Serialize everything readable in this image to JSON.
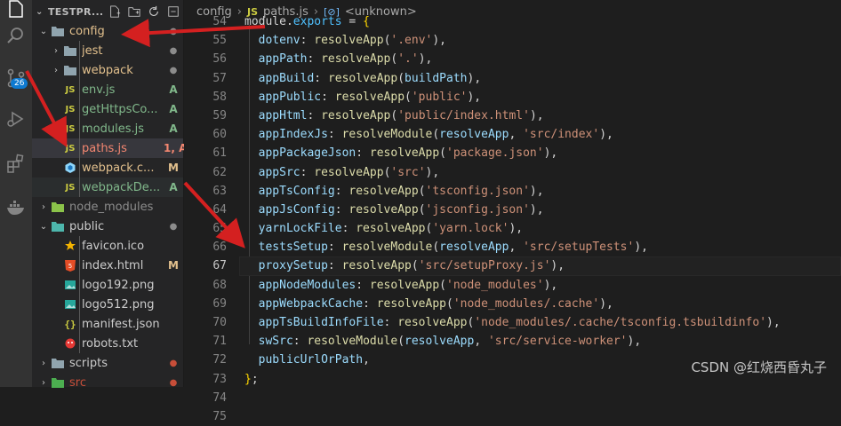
{
  "explorer": {
    "title": "TESTPR...",
    "actions": [
      "new-file-icon",
      "new-folder-icon",
      "refresh-icon",
      "collapse-all-icon"
    ]
  },
  "activity_bar": {
    "scm_badge": "26"
  },
  "tree": [
    {
      "label": "config",
      "type": "folder",
      "open": true,
      "indent": 0,
      "status": "dot",
      "statusColor": "#8c8c8c",
      "color": "#e2c08d"
    },
    {
      "label": "jest",
      "type": "folder",
      "open": false,
      "indent": 1,
      "status": "dot",
      "statusColor": "#8c8c8c",
      "color": "#e2c08d"
    },
    {
      "label": "webpack",
      "type": "folder",
      "open": false,
      "indent": 1,
      "status": "dot",
      "statusColor": "#8c8c8c",
      "color": "#e2c08d"
    },
    {
      "label": "env.js",
      "type": "js",
      "indent": 1,
      "status": "A",
      "statusColor": "#81b88b",
      "color": "#81b88b"
    },
    {
      "label": "getHttpsCo...",
      "type": "js",
      "indent": 1,
      "status": "A",
      "statusColor": "#81b88b",
      "color": "#81b88b"
    },
    {
      "label": "modules.js",
      "type": "js",
      "indent": 1,
      "status": "A",
      "statusColor": "#81b88b",
      "color": "#81b88b"
    },
    {
      "label": "paths.js",
      "type": "js",
      "indent": 1,
      "status": "1, A",
      "statusColor": "#f48771",
      "color": "#f48771",
      "selected": true
    },
    {
      "label": "webpack.c...",
      "type": "webpack",
      "indent": 1,
      "status": "M",
      "statusColor": "#e2c08d",
      "color": "#e2c08d"
    },
    {
      "label": "webpackDe...",
      "type": "js",
      "indent": 1,
      "status": "A",
      "statusColor": "#81b88b",
      "color": "#81b88b",
      "hover": true
    },
    {
      "label": "node_modules",
      "type": "nodefolder",
      "open": false,
      "indent": 0,
      "status": "",
      "statusColor": "#8c8c8c",
      "color": "#8c8c8c"
    },
    {
      "label": "public",
      "type": "publicfolder",
      "open": true,
      "indent": 0,
      "status": "dot",
      "statusColor": "#8c8c8c",
      "color": "#cccccc"
    },
    {
      "label": "favicon.ico",
      "type": "favicon",
      "indent": 1,
      "status": "",
      "statusColor": "#cccccc",
      "color": "#cccccc"
    },
    {
      "label": "index.html",
      "type": "html",
      "indent": 1,
      "status": "M",
      "statusColor": "#e2c08d",
      "color": "#cccccc"
    },
    {
      "label": "logo192.png",
      "type": "image",
      "indent": 1,
      "status": "",
      "statusColor": "#cccccc",
      "color": "#cccccc"
    },
    {
      "label": "logo512.png",
      "type": "image",
      "indent": 1,
      "status": "",
      "statusColor": "#cccccc",
      "color": "#cccccc"
    },
    {
      "label": "manifest.json",
      "type": "json",
      "indent": 1,
      "status": "",
      "statusColor": "#cccccc",
      "color": "#cccccc"
    },
    {
      "label": "robots.txt",
      "type": "robots",
      "indent": 1,
      "status": "",
      "statusColor": "#cccccc",
      "color": "#cccccc"
    },
    {
      "label": "scripts",
      "type": "folder",
      "open": false,
      "indent": 0,
      "status": "dot",
      "statusColor": "#c74e39",
      "color": "#cccccc"
    },
    {
      "label": "src",
      "type": "srcfolder",
      "open": false,
      "indent": 0,
      "status": "dot",
      "statusColor": "#c74e39",
      "color": "#c74e39"
    }
  ],
  "breadcrumb": {
    "folder": "config",
    "file_badge": "JS",
    "file": "paths.js",
    "symbol_icon": "symbol-variable-icon",
    "symbol": "<unknown>"
  },
  "editor": {
    "current_line": 67,
    "lines": [
      {
        "n": 54,
        "parts": [
          {
            "t": "module",
            "c": "k-white"
          },
          {
            "t": ".",
            "c": "k-white"
          },
          {
            "t": "exports",
            "c": "k-ltblue"
          },
          {
            "t": " = ",
            "c": "k-white"
          },
          {
            "t": "{",
            "c": "k-gold"
          }
        ]
      },
      {
        "n": 55,
        "parts": [
          {
            "t": "  dotenv",
            "c": "k-blue"
          },
          {
            "t": ": ",
            "c": "k-white"
          },
          {
            "t": "resolveApp",
            "c": "k-yel"
          },
          {
            "t": "(",
            "c": "k-white"
          },
          {
            "t": "'.env'",
            "c": "k-str"
          },
          {
            "t": "),",
            "c": "k-white"
          }
        ]
      },
      {
        "n": 56,
        "parts": [
          {
            "t": "  appPath",
            "c": "k-blue"
          },
          {
            "t": ": ",
            "c": "k-white"
          },
          {
            "t": "resolveApp",
            "c": "k-yel"
          },
          {
            "t": "(",
            "c": "k-white"
          },
          {
            "t": "'.'",
            "c": "k-str"
          },
          {
            "t": "),",
            "c": "k-white"
          }
        ]
      },
      {
        "n": 57,
        "parts": [
          {
            "t": "  appBuild",
            "c": "k-blue"
          },
          {
            "t": ": ",
            "c": "k-white"
          },
          {
            "t": "resolveApp",
            "c": "k-yel"
          },
          {
            "t": "(",
            "c": "k-white"
          },
          {
            "t": "buildPath",
            "c": "k-blue"
          },
          {
            "t": "),",
            "c": "k-white"
          }
        ]
      },
      {
        "n": 58,
        "parts": [
          {
            "t": "  appPublic",
            "c": "k-blue"
          },
          {
            "t": ": ",
            "c": "k-white"
          },
          {
            "t": "resolveApp",
            "c": "k-yel"
          },
          {
            "t": "(",
            "c": "k-white"
          },
          {
            "t": "'public'",
            "c": "k-str"
          },
          {
            "t": "),",
            "c": "k-white"
          }
        ]
      },
      {
        "n": 59,
        "parts": [
          {
            "t": "  appHtml",
            "c": "k-blue"
          },
          {
            "t": ": ",
            "c": "k-white"
          },
          {
            "t": "resolveApp",
            "c": "k-yel"
          },
          {
            "t": "(",
            "c": "k-white"
          },
          {
            "t": "'public/index.html'",
            "c": "k-str"
          },
          {
            "t": "),",
            "c": "k-white"
          }
        ]
      },
      {
        "n": 60,
        "parts": [
          {
            "t": "  appIndexJs",
            "c": "k-blue"
          },
          {
            "t": ": ",
            "c": "k-white"
          },
          {
            "t": "resolveModule",
            "c": "k-yel"
          },
          {
            "t": "(",
            "c": "k-white"
          },
          {
            "t": "resolveApp",
            "c": "k-blue"
          },
          {
            "t": ", ",
            "c": "k-white"
          },
          {
            "t": "'src/index'",
            "c": "k-str"
          },
          {
            "t": "),",
            "c": "k-white"
          }
        ]
      },
      {
        "n": 61,
        "parts": [
          {
            "t": "  appPackageJson",
            "c": "k-blue"
          },
          {
            "t": ": ",
            "c": "k-white"
          },
          {
            "t": "resolveApp",
            "c": "k-yel"
          },
          {
            "t": "(",
            "c": "k-white"
          },
          {
            "t": "'package.json'",
            "c": "k-str"
          },
          {
            "t": "),",
            "c": "k-white"
          }
        ]
      },
      {
        "n": 62,
        "parts": [
          {
            "t": "  appSrc",
            "c": "k-blue"
          },
          {
            "t": ": ",
            "c": "k-white"
          },
          {
            "t": "resolveApp",
            "c": "k-yel"
          },
          {
            "t": "(",
            "c": "k-white"
          },
          {
            "t": "'src'",
            "c": "k-str"
          },
          {
            "t": "),",
            "c": "k-white"
          }
        ]
      },
      {
        "n": 63,
        "parts": [
          {
            "t": "  appTsConfig",
            "c": "k-blue"
          },
          {
            "t": ": ",
            "c": "k-white"
          },
          {
            "t": "resolveApp",
            "c": "k-yel"
          },
          {
            "t": "(",
            "c": "k-white"
          },
          {
            "t": "'tsconfig.json'",
            "c": "k-str"
          },
          {
            "t": "),",
            "c": "k-white"
          }
        ]
      },
      {
        "n": 64,
        "parts": [
          {
            "t": "  appJsConfig",
            "c": "k-blue"
          },
          {
            "t": ": ",
            "c": "k-white"
          },
          {
            "t": "resolveApp",
            "c": "k-yel"
          },
          {
            "t": "(",
            "c": "k-white"
          },
          {
            "t": "'jsconfig.json'",
            "c": "k-str"
          },
          {
            "t": "),",
            "c": "k-white"
          }
        ]
      },
      {
        "n": 65,
        "parts": [
          {
            "t": "  yarnLockFile",
            "c": "k-blue"
          },
          {
            "t": ": ",
            "c": "k-white"
          },
          {
            "t": "resolveApp",
            "c": "k-yel"
          },
          {
            "t": "(",
            "c": "k-white"
          },
          {
            "t": "'yarn.lock'",
            "c": "k-str"
          },
          {
            "t": "),",
            "c": "k-white"
          }
        ]
      },
      {
        "n": 66,
        "parts": [
          {
            "t": "  testsSetup",
            "c": "k-blue"
          },
          {
            "t": ": ",
            "c": "k-white"
          },
          {
            "t": "resolveModule",
            "c": "k-yel"
          },
          {
            "t": "(",
            "c": "k-white"
          },
          {
            "t": "resolveApp",
            "c": "k-blue"
          },
          {
            "t": ", ",
            "c": "k-white"
          },
          {
            "t": "'src/setupTests'",
            "c": "k-str"
          },
          {
            "t": "),",
            "c": "k-white"
          }
        ]
      },
      {
        "n": 67,
        "parts": [
          {
            "t": "  proxySetup",
            "c": "k-blue"
          },
          {
            "t": ": ",
            "c": "k-white"
          },
          {
            "t": "resolveApp",
            "c": "k-yel"
          },
          {
            "t": "(",
            "c": "k-white"
          },
          {
            "t": "'src/setupProxy.js'",
            "c": "k-str"
          },
          {
            "t": "),",
            "c": "k-white"
          }
        ]
      },
      {
        "n": 68,
        "parts": [
          {
            "t": "  appNodeModules",
            "c": "k-blue"
          },
          {
            "t": ": ",
            "c": "k-white"
          },
          {
            "t": "resolveApp",
            "c": "k-yel"
          },
          {
            "t": "(",
            "c": "k-white"
          },
          {
            "t": "'node_modules'",
            "c": "k-str"
          },
          {
            "t": "),",
            "c": "k-white"
          }
        ]
      },
      {
        "n": 69,
        "parts": [
          {
            "t": "  appWebpackCache",
            "c": "k-blue"
          },
          {
            "t": ": ",
            "c": "k-white"
          },
          {
            "t": "resolveApp",
            "c": "k-yel"
          },
          {
            "t": "(",
            "c": "k-white"
          },
          {
            "t": "'node_modules/.cache'",
            "c": "k-str"
          },
          {
            "t": "),",
            "c": "k-white"
          }
        ]
      },
      {
        "n": 70,
        "parts": [
          {
            "t": "  appTsBuildInfoFile",
            "c": "k-blue"
          },
          {
            "t": ": ",
            "c": "k-white"
          },
          {
            "t": "resolveApp",
            "c": "k-yel"
          },
          {
            "t": "(",
            "c": "k-white"
          },
          {
            "t": "'node_modules/.cache/tsconfig.tsbuildinfo'",
            "c": "k-str"
          },
          {
            "t": "),",
            "c": "k-white"
          }
        ]
      },
      {
        "n": 71,
        "parts": [
          {
            "t": "  swSrc",
            "c": "k-blue"
          },
          {
            "t": ": ",
            "c": "k-white"
          },
          {
            "t": "resolveModule",
            "c": "k-yel"
          },
          {
            "t": "(",
            "c": "k-white"
          },
          {
            "t": "resolveApp",
            "c": "k-blue"
          },
          {
            "t": ", ",
            "c": "k-white"
          },
          {
            "t": "'src/service-worker'",
            "c": "k-str"
          },
          {
            "t": "),",
            "c": "k-white"
          }
        ]
      },
      {
        "n": 72,
        "parts": [
          {
            "t": "  publicUrlOrPath",
            "c": "k-blue"
          },
          {
            "t": ",",
            "c": "k-white"
          }
        ]
      },
      {
        "n": 73,
        "parts": [
          {
            "t": "}",
            "c": "k-gold"
          },
          {
            "t": ";",
            "c": "k-white"
          }
        ]
      },
      {
        "n": 74,
        "parts": []
      },
      {
        "n": 75,
        "parts": []
      }
    ]
  },
  "watermark": "CSDN @红烧西昏丸子",
  "annotation_color": "#d42020"
}
